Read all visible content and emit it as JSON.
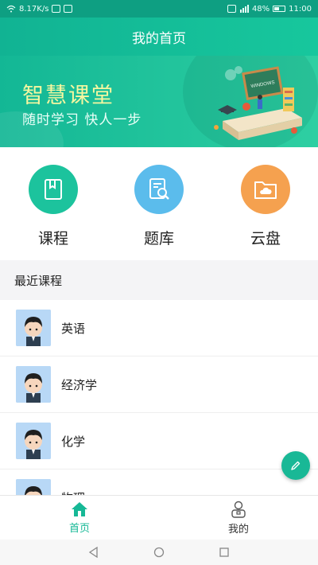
{
  "status_bar": {
    "speed": "8.17K/s",
    "battery": "48%",
    "time": "11:00"
  },
  "header": {
    "title": "我的首页"
  },
  "banner": {
    "title": "智慧课堂",
    "subtitle": "随时学习 快人一步",
    "art_board_text": "WINDOWS"
  },
  "entries": [
    {
      "label": "课程",
      "icon": "book-icon",
      "color": "#1cc39d"
    },
    {
      "label": "题库",
      "icon": "document-search-icon",
      "color": "#5bbcec"
    },
    {
      "label": "云盘",
      "icon": "cloud-folder-icon",
      "color": "#f5a14f"
    }
  ],
  "recent": {
    "title": "最近课程",
    "courses": [
      {
        "name": "英语"
      },
      {
        "name": "经济学"
      },
      {
        "name": "化学"
      },
      {
        "name": "物理"
      }
    ]
  },
  "tab_bar": {
    "tabs": [
      {
        "label": "首页",
        "icon": "home-icon",
        "active": true
      },
      {
        "label": "我的",
        "icon": "user-icon",
        "active": false
      }
    ]
  },
  "colors": {
    "accent": "#16b896",
    "banner_title": "#f6f7a0"
  }
}
